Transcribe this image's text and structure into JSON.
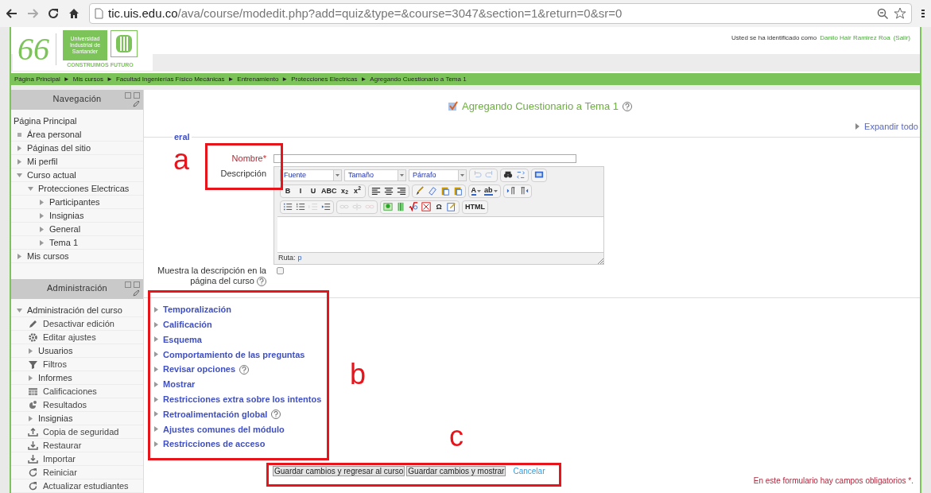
{
  "browser": {
    "url_host": "tic.uis.edu.co",
    "url_path": "/ava/course/modedit.php?add=quiz&type=&course=3047&section=1&return=0&sr=0"
  },
  "header": {
    "logo_number": "66",
    "logo_university": "Universidad Industrial de Santander",
    "logo_tagline": "CONSTRUIMOS FUTURO",
    "login_prefix": "Usted se ha identificado como",
    "user_name": "Danilo Hair Ramirez Roa",
    "logout": "(Salir)"
  },
  "breadcrumb": {
    "separator": "►",
    "items": [
      "Página Principal",
      "Mis cursos",
      "Facultad Ingenierías Físico Mecánicas",
      "Entrenamiento",
      "Protecciones Electricas",
      "Agregando Cuestionario a Tema 1"
    ]
  },
  "navigation": {
    "title": "Navegación",
    "items": [
      {
        "label": "Página Principal",
        "kind": "root"
      },
      {
        "label": "Área personal",
        "kind": "leaf"
      },
      {
        "label": "Páginas del sitio",
        "kind": "branch",
        "expanded": false
      },
      {
        "label": "Mi perfil",
        "kind": "branch",
        "expanded": false
      },
      {
        "label": "Curso actual",
        "kind": "branch",
        "expanded": true,
        "children": [
          {
            "label": "Protecciones Electricas",
            "kind": "branch",
            "expanded": true,
            "children": [
              {
                "label": "Participantes",
                "kind": "branch",
                "expanded": false
              },
              {
                "label": "Insignias",
                "kind": "branch",
                "expanded": false
              },
              {
                "label": "General",
                "kind": "branch",
                "expanded": false
              },
              {
                "label": "Tema 1",
                "kind": "branch",
                "expanded": false
              }
            ]
          }
        ]
      },
      {
        "label": "Mis cursos",
        "kind": "branch",
        "expanded": false
      }
    ]
  },
  "administration": {
    "title": "Administración",
    "items": [
      {
        "label": "Administración del curso",
        "kind": "branch",
        "expanded": true,
        "children": [
          {
            "label": "Desactivar edición",
            "kind": "action"
          },
          {
            "label": "Editar ajustes",
            "kind": "action"
          },
          {
            "label": "Usuarios",
            "kind": "branch",
            "expanded": false
          },
          {
            "label": "Filtros",
            "kind": "action"
          },
          {
            "label": "Informes",
            "kind": "branch",
            "expanded": false
          },
          {
            "label": "Calificaciones",
            "kind": "action"
          },
          {
            "label": "Resultados",
            "kind": "action"
          },
          {
            "label": "Insignias",
            "kind": "branch",
            "expanded": false
          },
          {
            "label": "Copia de seguridad",
            "kind": "action"
          },
          {
            "label": "Restaurar",
            "kind": "action"
          },
          {
            "label": "Importar",
            "kind": "action"
          },
          {
            "label": "Reiniciar",
            "kind": "action"
          },
          {
            "label": "Actualizar estudiantes",
            "kind": "action"
          }
        ]
      }
    ]
  },
  "form": {
    "title": "Agregando Cuestionario a Tema 1",
    "expand_all": "Expandir todo",
    "legend": "eral",
    "fields": [
      {
        "kind": "text",
        "label": "Nombre",
        "required_mark": "*"
      },
      {
        "kind": "editor",
        "label": "Descripción",
        "selects": [
          "Fuente",
          "Tamaño",
          "Párrafo"
        ],
        "path_label": "Ruta:",
        "path_value": "p",
        "toolbar": [
          [
            [
              {
                "kind": "icon",
                "disabled": true
              },
              {
                "kind": "icon",
                "disabled": true
              }
            ],
            [
              {
                "kind": "icon",
                "disabled": false
              },
              {
                "kind": "icon",
                "disabled": false
              }
            ],
            [
              {
                "kind": "icon",
                "disabled": false
              }
            ]
          ],
          [
            [
              {
                "kind": "text",
                "label": "B",
                "disabled": false
              },
              {
                "kind": "text",
                "label": "I",
                "disabled": false
              },
              {
                "kind": "text",
                "label": "U",
                "disabled": false
              },
              {
                "kind": "text",
                "label": "ABC",
                "disabled": false
              },
              {
                "kind": "text",
                "label": "x$_{2}$",
                "disabled": false
              },
              {
                "kind": "text",
                "label": "x$^{2}$",
                "disabled": false
              }
            ],
            [
              {
                "kind": "icon",
                "disabled": false
              },
              {
                "kind": "icon",
                "disabled": false
              },
              {
                "kind": "icon",
                "disabled": false
              }
            ],
            [
              {
                "kind": "icon",
                "disabled": false
              },
              {
                "kind": "icon",
                "disabled": false
              },
              {
                "kind": "icon",
                "disabled": false
              },
              {
                "kind": "icon",
                "disabled": false
              }
            ],
            [
              {
                "kind": "text_dropdown",
                "label": "A",
                "disabled": false
              },
              {
                "kind": "text_dropdown",
                "label": "ab",
                "disabled": false
              }
            ],
            [
              {
                "kind": "icon",
                "disabled": false
              },
              {
                "kind": "icon",
                "disabled": false
              }
            ]
          ],
          [
            [
              {
                "kind": "icon",
                "disabled": false
              },
              {
                "kind": "icon",
                "disabled": false
              },
              {
                "kind": "icon",
                "disabled": true
              },
              {
                "kind": "icon",
                "disabled": false
              }
            ],
            [
              {
                "kind": "icon",
                "disabled": true
              },
              {
                "kind": "icon",
                "disabled": true
              },
              {
                "kind": "icon",
                "disabled": true
              }
            ],
            [
              {
                "kind": "icon",
                "disabled": false
              },
              {
                "kind": "icon",
                "disabled": false
              },
              {
                "kind": "icon",
                "disabled": false
              },
              {
                "kind": "icon",
                "disabled": false
              },
              {
                "kind": "text",
                "label": "Ω",
                "disabled": false
              },
              {
                "kind": "icon",
                "disabled": false
              }
            ],
            [
              {
                "kind": "text",
                "label": "HTML",
                "disabled": false
              }
            ]
          ]
        ]
      },
      {
        "kind": "checkbox",
        "label": "Muestra la descripción en la página del curso",
        "checked": false,
        "help": true
      }
    ],
    "sections": [
      {
        "label": "Temporalización",
        "expanded": false,
        "help": false
      },
      {
        "label": "Calificación",
        "expanded": false,
        "help": false
      },
      {
        "label": "Esquema",
        "expanded": false,
        "help": false
      },
      {
        "label": "Comportamiento de las preguntas",
        "expanded": false,
        "help": false
      },
      {
        "label": "Revisar opciones",
        "expanded": false,
        "help": true
      },
      {
        "label": "Mostrar",
        "expanded": false,
        "help": false
      },
      {
        "label": "Restricciones extra sobre los intentos",
        "expanded": false,
        "help": false
      },
      {
        "label": "Retroalimentación global",
        "expanded": false,
        "help": true
      },
      {
        "label": "Ajustes comunes del módulo",
        "expanded": false,
        "help": false
      },
      {
        "label": "Restricciones de acceso",
        "expanded": false,
        "help": false
      }
    ],
    "buttons": [
      "Guardar cambios y regresar al curso",
      "Guardar cambios y mostrar"
    ],
    "cancel": "Cancelar",
    "required_note": "En este formulario hay campos obligatorios *."
  },
  "annotations": [
    {
      "label": "a"
    },
    {
      "label": "b"
    },
    {
      "label": "c"
    }
  ]
}
